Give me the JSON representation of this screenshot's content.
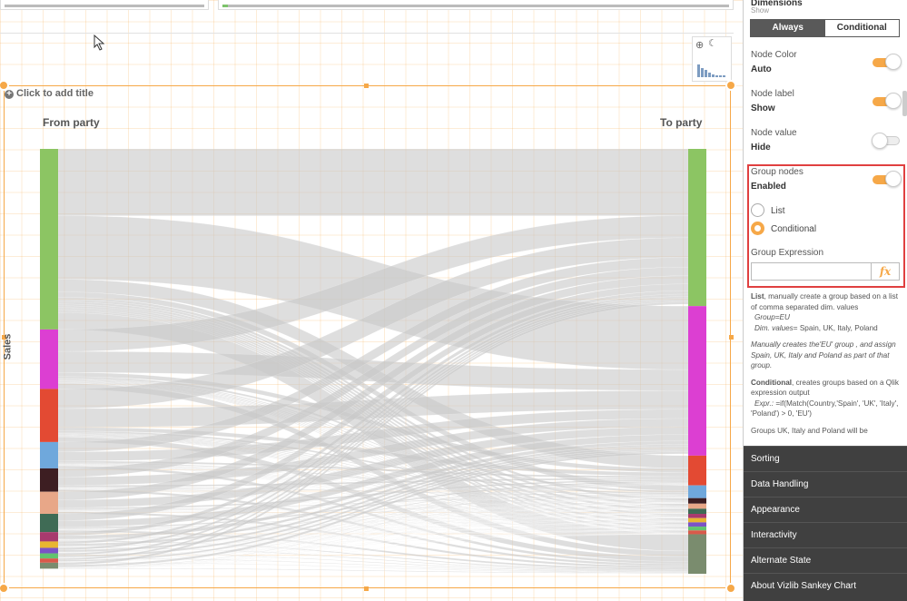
{
  "chart": {
    "add_title": "Click to add title",
    "from_label": "From party",
    "to_label": "To party",
    "y_label": "Sales"
  },
  "chart_data": {
    "type": "sankey",
    "title": "",
    "ylabel": "Sales",
    "from_axis": "From party",
    "to_axis": "To party",
    "source_nodes": [
      {
        "color": "#8cc563",
        "share": 0.425
      },
      {
        "color": "#dc3fd2",
        "share": 0.14
      },
      {
        "color": "#e34a33",
        "share": 0.125
      },
      {
        "color": "#6fa8dc",
        "share": 0.062
      },
      {
        "color": "#3d1e22",
        "share": 0.055
      },
      {
        "color": "#e8a788",
        "share": 0.052
      },
      {
        "color": "#3f6b55",
        "share": 0.043
      },
      {
        "color": "#a83a6e",
        "share": 0.022
      },
      {
        "color": "#e8b631",
        "share": 0.015
      },
      {
        "color": "#7b53c6",
        "share": 0.013
      },
      {
        "color": "#62c46f",
        "share": 0.012
      },
      {
        "color": "#d95a4b",
        "share": 0.01
      },
      {
        "color": "#7a8c6e",
        "share": 0.014
      }
    ],
    "target_nodes": [
      {
        "color": "#8cc563",
        "share": 0.37
      },
      {
        "color": "#dc3fd2",
        "share": 0.352
      },
      {
        "color": "#e34a33",
        "share": 0.07
      },
      {
        "color": "#6fa8dc",
        "share": 0.03
      },
      {
        "color": "#3d1e22",
        "share": 0.013
      },
      {
        "color": "#e8a788",
        "share": 0.012
      },
      {
        "color": "#3f6b55",
        "share": 0.012
      },
      {
        "color": "#a83a6e",
        "share": 0.01
      },
      {
        "color": "#e8b631",
        "share": 0.01
      },
      {
        "color": "#7b53c6",
        "share": 0.01
      },
      {
        "color": "#62c46f",
        "share": 0.009
      },
      {
        "color": "#d95a4b",
        "share": 0.009
      },
      {
        "color": "#7a8c6e",
        "share": 0.093
      }
    ],
    "link_color": "#c8c8c8"
  },
  "panel": {
    "section": "Dimensions",
    "show_label": "Show",
    "seg_always": "Always",
    "seg_conditional": "Conditional",
    "node_color_label": "Node Color",
    "node_color_value": "Auto",
    "node_label_label": "Node label",
    "node_label_value": "Show",
    "node_value_label": "Node value",
    "node_value_value": "Hide",
    "group_nodes_label": "Group nodes",
    "group_nodes_value": "Enabled",
    "radio_list": "List",
    "radio_conditional": "Conditional",
    "group_expression_label": "Group Expression",
    "group_expression_value": "",
    "fx": "fx",
    "help_list_bold": "List",
    "help_list_text": ", manually create a group based on a list of comma separated dim. values",
    "help_group_eq": "Group=EU",
    "help_dim_values_label": "Dim. values",
    "help_dim_values": "= Spain, UK, Italy, Poland",
    "help_manual": "Manually creates the'EU' group , and assign Spain, UK, Italy and Poland as part of that group.",
    "help_cond_bold": "Conditional",
    "help_cond_text": ", creates groups based on a Qlik expression output",
    "help_expr_label": "Expr.:",
    "help_expr": " =if(Match(Country,'Spain', 'UK', 'Italy', 'Poland') > 0, 'EU')",
    "help_cut": "Groups UK, Italy and Poland will be",
    "accordion": [
      "Sorting",
      "Data Handling",
      "Appearance",
      "Interactivity",
      "Alternate State",
      "About Vizlib Sankey Chart"
    ]
  }
}
